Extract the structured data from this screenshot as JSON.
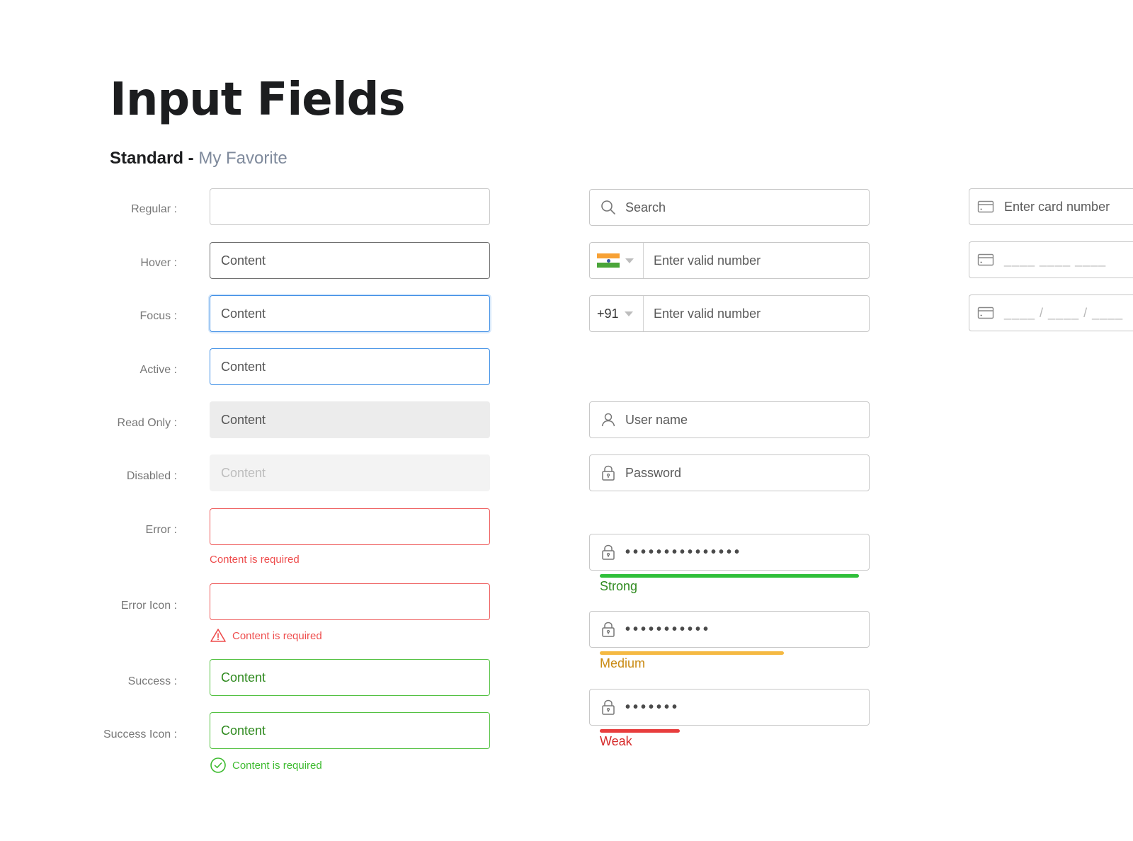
{
  "header": {
    "title": "Input Fields",
    "subtitle_bold": "Standard -",
    "subtitle_light": "My Favorite"
  },
  "states": [
    {
      "label": "Regular :",
      "value": ""
    },
    {
      "label": "Hover :",
      "value": "Content"
    },
    {
      "label": "Focus :",
      "value": "Content"
    },
    {
      "label": "Active :",
      "value": "Content"
    },
    {
      "label": "Read Only :",
      "value": "Content"
    },
    {
      "label": "Disabled :",
      "value": "Content"
    },
    {
      "label": "Error :",
      "value": "",
      "message": "Content is required"
    },
    {
      "label": "Error Icon :",
      "value": "",
      "message": "Content is required"
    },
    {
      "label": "Success :",
      "value": "Content"
    },
    {
      "label": "Success Icon :",
      "value": "Content",
      "message": "Content is required"
    }
  ],
  "search": {
    "placeholder": "Search",
    "icon": "search-icon"
  },
  "phone_flag": {
    "placeholder": "Enter valid number",
    "country": "India",
    "flag_colors": [
      "#f7a135",
      "#ffffff",
      "#4aa53a"
    ]
  },
  "phone_code": {
    "code": "+91",
    "placeholder": "Enter valid number"
  },
  "login": {
    "username_placeholder": "User name",
    "password_placeholder": "Password"
  },
  "password_strength": [
    {
      "mask": "•••••••••••••••",
      "label": "Strong",
      "level": 1.0,
      "bar_color": "#2fbf3a",
      "label_color": "#2f8a1f"
    },
    {
      "mask": "•••••••••••",
      "label": "Medium",
      "level": 0.71,
      "bar_color": "#f5b942",
      "label_color": "#c98a12"
    },
    {
      "mask": "•••••••",
      "label": "Weak",
      "level": 0.31,
      "bar_color": "#e83d3d",
      "label_color": "#d62a2a"
    }
  ],
  "card": {
    "placeholder": "Enter card number",
    "mask_groups": "____   ____   ____",
    "mask_slashes": "____ / ____ / ____"
  },
  "colors": {
    "focus": "#3f8fe6",
    "error": "#ee5b5b",
    "success": "#54c142"
  }
}
